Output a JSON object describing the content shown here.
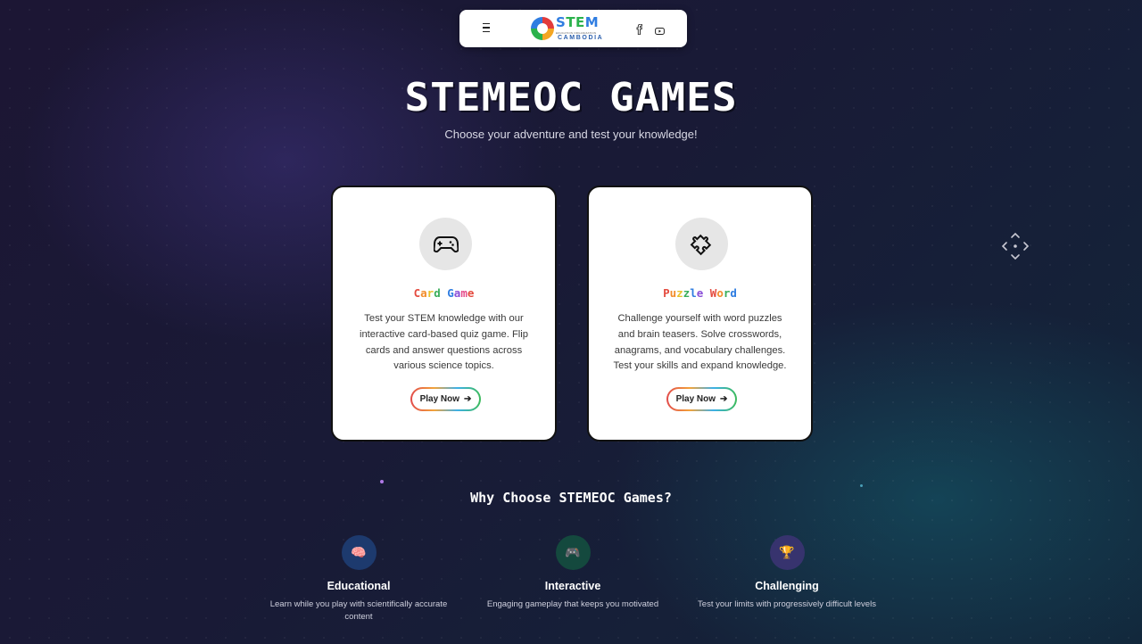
{
  "nav": {
    "logo_title": "STEM",
    "logo_subtitle": "EDUCATION ORGANIZATION",
    "logo_country": "CAMBODIA"
  },
  "hero": {
    "title": "STEMEOC GAMES",
    "subtitle": "Choose your adventure and test your knowledge!"
  },
  "cards": [
    {
      "icon": "gamepad-icon",
      "title": "Card Game",
      "description": "Test your STEM knowledge with our interactive card-based quiz game. Flip cards and answer questions across various science topics.",
      "button": "Play Now",
      "title_colors": [
        "#e44b3f",
        "#f28c2a",
        "#e8c12a",
        "#3aae5a",
        "#2f7de1",
        "#8a4fd8",
        "#e44b8a",
        "#e44b3f",
        "#3aae5a"
      ]
    },
    {
      "icon": "puzzle-icon",
      "title": "Puzzle Word",
      "description": "Challenge yourself with word puzzles and brain teasers. Solve crosswords, anagrams, and vocabulary challenges. Test your skills and expand knowledge.",
      "button": "Play Now",
      "title_colors": [
        "#e44b3f",
        "#f28c2a",
        "#e8c12a",
        "#3aae5a",
        "#2f7de1",
        "#8a4fd8",
        "#e44b3f",
        "#f28c2a",
        "#3aae5a",
        "#2f7de1",
        "#e44b8a"
      ]
    }
  ],
  "why": {
    "title": "Why Choose STEMEOC Games?",
    "features": [
      {
        "icon": "brain-icon",
        "emoji": "🧠",
        "title": "Educational",
        "description": "Learn while you play with scientifically accurate content",
        "bg": "#1d3a6e"
      },
      {
        "icon": "game-controller-icon",
        "emoji": "🎮",
        "title": "Interactive",
        "description": "Engaging gameplay that keeps you motivated",
        "bg": "#14493e"
      },
      {
        "icon": "trophy-icon",
        "emoji": "🏆",
        "title": "Challenging",
        "description": "Test your limits with progressively difficult levels",
        "bg": "#37336e"
      }
    ]
  },
  "colors": {
    "accent_red": "#e44b3f",
    "accent_green": "#3aae5a",
    "accent_blue": "#2f7de1"
  }
}
